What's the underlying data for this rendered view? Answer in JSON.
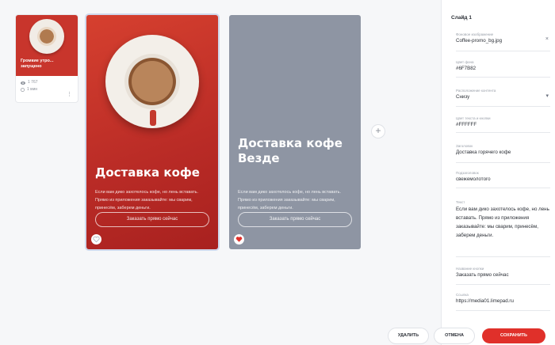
{
  "thumbnail": {
    "title": "Громкие утро... запущено",
    "views": "1 767",
    "time": "1 мин",
    "more_icon": "more-vertical-icon"
  },
  "slides": [
    {
      "title": "Доставка кофе",
      "text": "Если вам дико захотелось кофе, но лень вставать. Прямо из приложения заказывайте: мы сварим, принесём, заберем деньги.",
      "button": "Заказать прямо сейчас",
      "liked": false
    },
    {
      "title": "Доставка кофе Везде",
      "text": "Если вам дико захотелось кофе, но лень вставать. Прямо из приложения заказывайте: мы сварим, принесём, заберем деньги.",
      "button": "Заказать прямо сейчас",
      "liked": true
    }
  ],
  "add_button": "+",
  "panel": {
    "title": "Слайд 1",
    "fields": [
      {
        "label": "Фоновое изображение",
        "value": "Coffee-promo_bg.jpg",
        "side": "×"
      },
      {
        "label": "Цвет фона",
        "value": "#6F7B82"
      },
      {
        "label": "Расположение контента",
        "value": "Снизу",
        "side": "▾"
      },
      {
        "label": "Цвет текста и кнопки",
        "value": "#FFFFFF"
      },
      {
        "label": "Заголовок",
        "value": "Доставка горячего кофе"
      },
      {
        "label": "Подзаголовок",
        "value": "свежемолотого"
      },
      {
        "label": "Текст",
        "value": "Если вам дико захотелось кофе, но лень вставать. Прямо из приложения заказывайте: мы сварим, принесём, заберем деньги."
      },
      {
        "label": "Название кнопки",
        "value": "Заказать прямо сейчас"
      },
      {
        "label": "Ссылка",
        "value": "https://media01.limepad.ru"
      }
    ]
  },
  "footer": {
    "delete": "УДАЛИТЬ",
    "cancel": "ОТМЕНА",
    "save": "СОХРАНИТЬ"
  },
  "colors": {
    "accent": "#e0302a",
    "slide_red": "#c8352c",
    "slide_gray": "#8e95a3"
  }
}
